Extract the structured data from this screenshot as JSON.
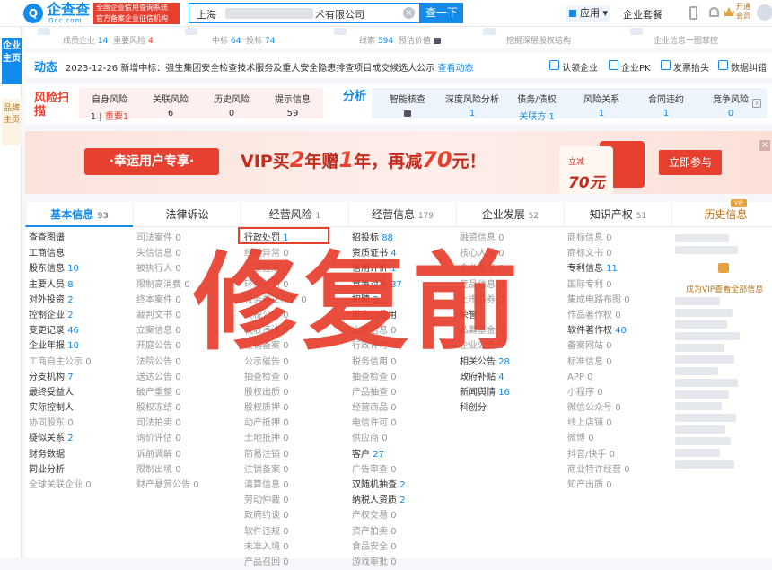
{
  "brand": {
    "logo_text": "企查查",
    "domain": "Qcc.com",
    "badge_line1": "全国企业信用查询系统",
    "badge_line2": "官方备案企业征信机构"
  },
  "search": {
    "value_prefix": "上海",
    "value_suffix": "术有限公司",
    "button": "查一下"
  },
  "header": {
    "app_label": "应用",
    "package_label": "企业套餐",
    "vip_label": "开通会员"
  },
  "rail": {
    "primary": "企业主页",
    "secondary": "品牌主页"
  },
  "stats": [
    {
      "label": "成员企业",
      "value": "14",
      "label2": "重要风险",
      "value2": "4"
    },
    {
      "label": "中标",
      "value": "64",
      "label2": "投标",
      "value2": "74"
    },
    {
      "label": "线索",
      "value": "594",
      "label2": "预估价值"
    },
    {
      "label": "挖掘深层股权结构"
    },
    {
      "label": "企业信息一图掌控"
    }
  ],
  "dynamic": {
    "title": "动态",
    "date": "2023-12-26",
    "text": "新增中标：强生集团安全检查技术服务及重大安全隐患排查项目成交候选人公示",
    "link": "查看动态"
  },
  "quick_links": [
    "认领企业",
    "企业PK",
    "发票抬头",
    "数据纠错"
  ],
  "risk": {
    "title": "风险扫描",
    "items": [
      {
        "label": "自身风险",
        "value": "1",
        "extra": "重要1"
      },
      {
        "label": "关联风险",
        "value": "6"
      },
      {
        "label": "历史风险",
        "value": "0"
      },
      {
        "label": "提示信息",
        "value": "59"
      }
    ]
  },
  "analysis": {
    "title": "分析",
    "items": [
      {
        "label": "智能核查",
        "value": ""
      },
      {
        "label": "深度风险分析",
        "value": "1"
      },
      {
        "label": "债务/债权",
        "value": "关联方 1"
      },
      {
        "label": "风险关系",
        "value": "1"
      },
      {
        "label": "合同违约",
        "value": "1"
      },
      {
        "label": "竞争风险",
        "value": "0"
      }
    ]
  },
  "banner": {
    "pill": "·幸运用户专享·",
    "text1": "VIP买",
    "n1": "2",
    "text2": "年赠",
    "n2": "1",
    "text3": "年，再减",
    "n3": "70",
    "text4": "元！",
    "card_title": "立减",
    "card_value": "70元",
    "cta": "立即参与"
  },
  "tabs": [
    {
      "label": "基本信息",
      "count": "93"
    },
    {
      "label": "法律诉讼",
      "count": ""
    },
    {
      "label": "经营风险",
      "count": "1"
    },
    {
      "label": "经营信息",
      "count": "179"
    },
    {
      "label": "企业发展",
      "count": "52"
    },
    {
      "label": "知识产权",
      "count": "51"
    },
    {
      "label": "历史信息",
      "count": ""
    }
  ],
  "columns": {
    "basic": [
      [
        "查查图谱",
        ""
      ],
      [
        "工商信息",
        ""
      ],
      [
        "股东信息",
        "10"
      ],
      [
        "主要人员",
        "8"
      ],
      [
        "对外投资",
        "2"
      ],
      [
        "控制企业",
        "2"
      ],
      [
        "变更记录",
        "46"
      ],
      [
        "企业年报",
        "10"
      ],
      [
        "工商自主公示",
        "0"
      ],
      [
        "分支机构",
        "7"
      ],
      [
        "最终受益人",
        ""
      ],
      [
        "实际控制人",
        ""
      ],
      [
        "协同股东",
        "0"
      ],
      [
        "疑似关系",
        "2"
      ],
      [
        "财务数据",
        ""
      ],
      [
        "同业分析",
        ""
      ],
      [
        "全球关联企业",
        "0"
      ]
    ],
    "legal": [
      [
        "司法案件",
        "0"
      ],
      [
        "失信信息",
        "0"
      ],
      [
        "被执行人",
        "0"
      ],
      [
        "限制高消费",
        "0"
      ],
      [
        "终本案件",
        "0"
      ],
      [
        "裁判文书",
        "0"
      ],
      [
        "立案信息",
        "0"
      ],
      [
        "开庭公告",
        "0"
      ],
      [
        "法院公告",
        "0"
      ],
      [
        "送达公告",
        "0"
      ],
      [
        "破产重整",
        "0"
      ],
      [
        "股权冻结",
        "0"
      ],
      [
        "司法拍卖",
        "0"
      ],
      [
        "询价评估",
        "0"
      ],
      [
        "诉前调解",
        "0"
      ],
      [
        "限制出境",
        "0"
      ],
      [
        "财产悬赏公告",
        "0"
      ]
    ],
    "risk": [
      [
        "行政处罚",
        "1"
      ],
      [
        "经营异常",
        "0"
      ],
      [
        "严重违法",
        "0"
      ],
      [
        "环保处罚",
        "0"
      ],
      [
        "税务非正常户",
        "0"
      ],
      [
        "欠税公告",
        "0"
      ],
      [
        "税收违法",
        "0"
      ],
      [
        "注销备案",
        "0"
      ],
      [
        "公示催告",
        "0"
      ],
      [
        "抽查检查",
        "0"
      ],
      [
        "股权出质",
        "0"
      ],
      [
        "股权质押",
        "0"
      ],
      [
        "动产抵押",
        "0"
      ],
      [
        "土地抵押",
        "0"
      ],
      [
        "简易注销",
        "0"
      ],
      [
        "注销备案",
        "0"
      ],
      [
        "清算信息",
        "0"
      ],
      [
        "劳动仲裁",
        "0"
      ],
      [
        "政府约谈",
        "0"
      ],
      [
        "软件违规",
        "0"
      ],
      [
        "未准入境",
        "0"
      ],
      [
        "产品召回",
        "0"
      ]
    ],
    "ops": [
      [
        "招投标",
        "88"
      ],
      [
        "资质证书",
        "4"
      ],
      [
        "信用评价",
        "1"
      ],
      [
        "竞争对手",
        "37"
      ],
      [
        "招聘",
        "2"
      ],
      [
        "进出口信用",
        ""
      ],
      [
        "土地信息",
        "0"
      ],
      [
        "行政许可",
        "0"
      ],
      [
        "税务信用",
        "0"
      ],
      [
        "抽查检查",
        "0"
      ],
      [
        "产品抽查",
        "0"
      ],
      [
        "经营商品",
        "0"
      ],
      [
        "电信许可",
        "0"
      ],
      [
        "供应商",
        "0"
      ],
      [
        "客户",
        "27"
      ],
      [
        "广告审查",
        "0"
      ],
      [
        "双随机抽查",
        "2"
      ],
      [
        "纳税人资质",
        "2"
      ],
      [
        "产权交易",
        "0"
      ],
      [
        "资产拍卖",
        "0"
      ],
      [
        "食品安全",
        "0"
      ],
      [
        "游戏审批",
        "0"
      ]
    ],
    "dev": [
      [
        "融资信息",
        "0"
      ],
      [
        "核心人员",
        "0"
      ],
      [
        "企业业务",
        "0"
      ],
      [
        "竞品信息",
        "0"
      ],
      [
        "上市债券",
        "0"
      ],
      [
        "荣誉",
        ""
      ],
      [
        "私募基金",
        "0"
      ],
      [
        "企业公告",
        "0"
      ],
      [
        "相关公告",
        "28"
      ],
      [
        "政府补贴",
        "4"
      ],
      [
        "新闻舆情",
        "16"
      ],
      [
        "科创分",
        ""
      ]
    ],
    "ip": [
      [
        "商标信息",
        "0"
      ],
      [
        "商标文书",
        "0"
      ],
      [
        "专利信息",
        "11"
      ],
      [
        "国际专利",
        "0"
      ],
      [
        "集成电路布图",
        "0"
      ],
      [
        "作品著作权",
        "0"
      ],
      [
        "软件著作权",
        "40"
      ],
      [
        "备案网站",
        "0"
      ],
      [
        "标准信息",
        "0"
      ],
      [
        "APP",
        "0"
      ],
      [
        "小程序",
        "0"
      ],
      [
        "微信公众号",
        "0"
      ],
      [
        "线上店铺",
        "0"
      ],
      [
        "微博",
        "0"
      ],
      [
        "抖音/快手",
        "0"
      ],
      [
        "商业特许经营",
        "0"
      ],
      [
        "知产出质",
        "0"
      ]
    ]
  },
  "history": {
    "cta": "成为VIP查看全部信息"
  },
  "watermark": "修复前"
}
